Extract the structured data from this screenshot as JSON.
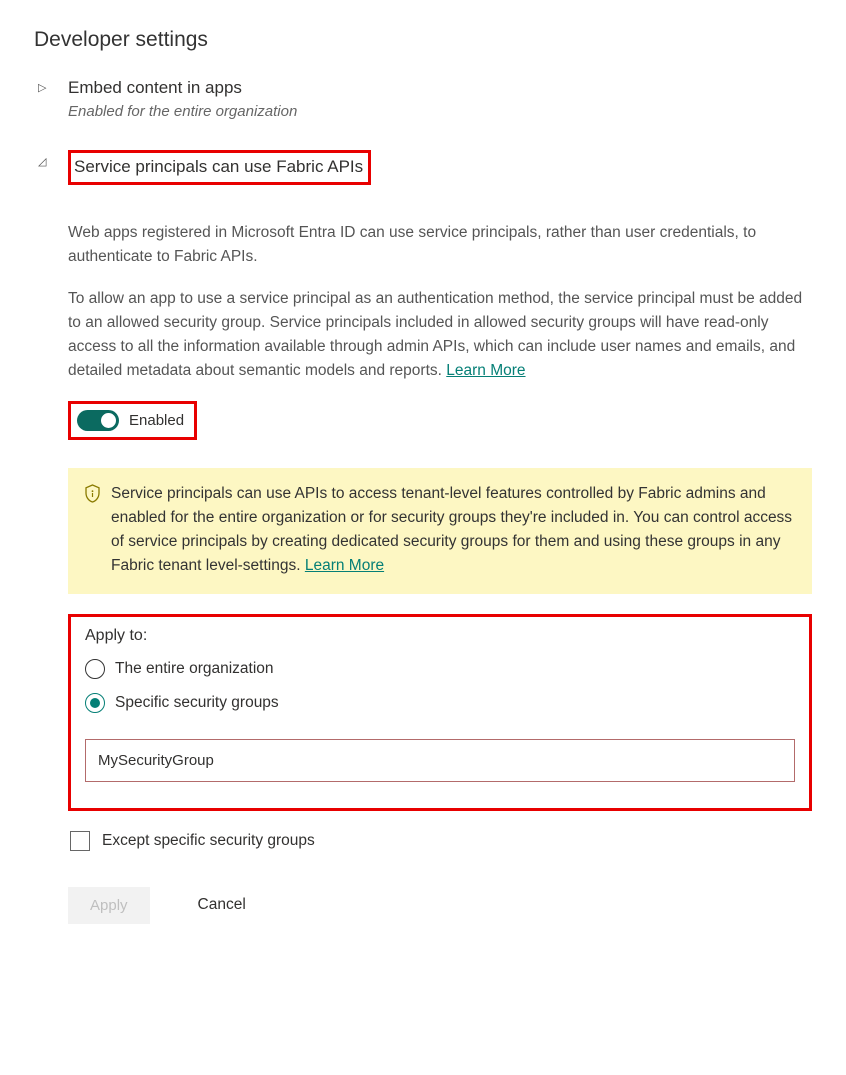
{
  "section_title": "Developer settings",
  "settings": [
    {
      "title": "Embed content in apps",
      "subtitle": "Enabled for the entire organization"
    },
    {
      "title": "Service principals can use Fabric APIs",
      "description_1": "Web apps registered in Microsoft Entra ID can use service principals, rather than user credentials, to authenticate to Fabric APIs.",
      "description_2": "To allow an app to use a service principal as an authentication method, the service principal must be added to an allowed security group. Service principals included in allowed security groups will have read-only access to all the information available through admin APIs, which can include user names and emails, and detailed metadata about semantic models and reports.  ",
      "learn_more": "Learn More",
      "toggle_label": "Enabled",
      "info_text": "Service principals can use APIs to access tenant-level features controlled by Fabric admins and enabled for the entire organization or for security groups they're included in. You can control access of service principals by creating dedicated security groups for them and using these groups in any Fabric tenant level-settings.  ",
      "info_learn_more": "Learn More",
      "apply_label": "Apply to:",
      "radio_entire": "The entire organization",
      "radio_specific": "Specific security groups",
      "input_value": "MySecurityGroup",
      "except_label": "Except specific security groups",
      "apply_btn": "Apply",
      "cancel_btn": "Cancel"
    }
  ]
}
